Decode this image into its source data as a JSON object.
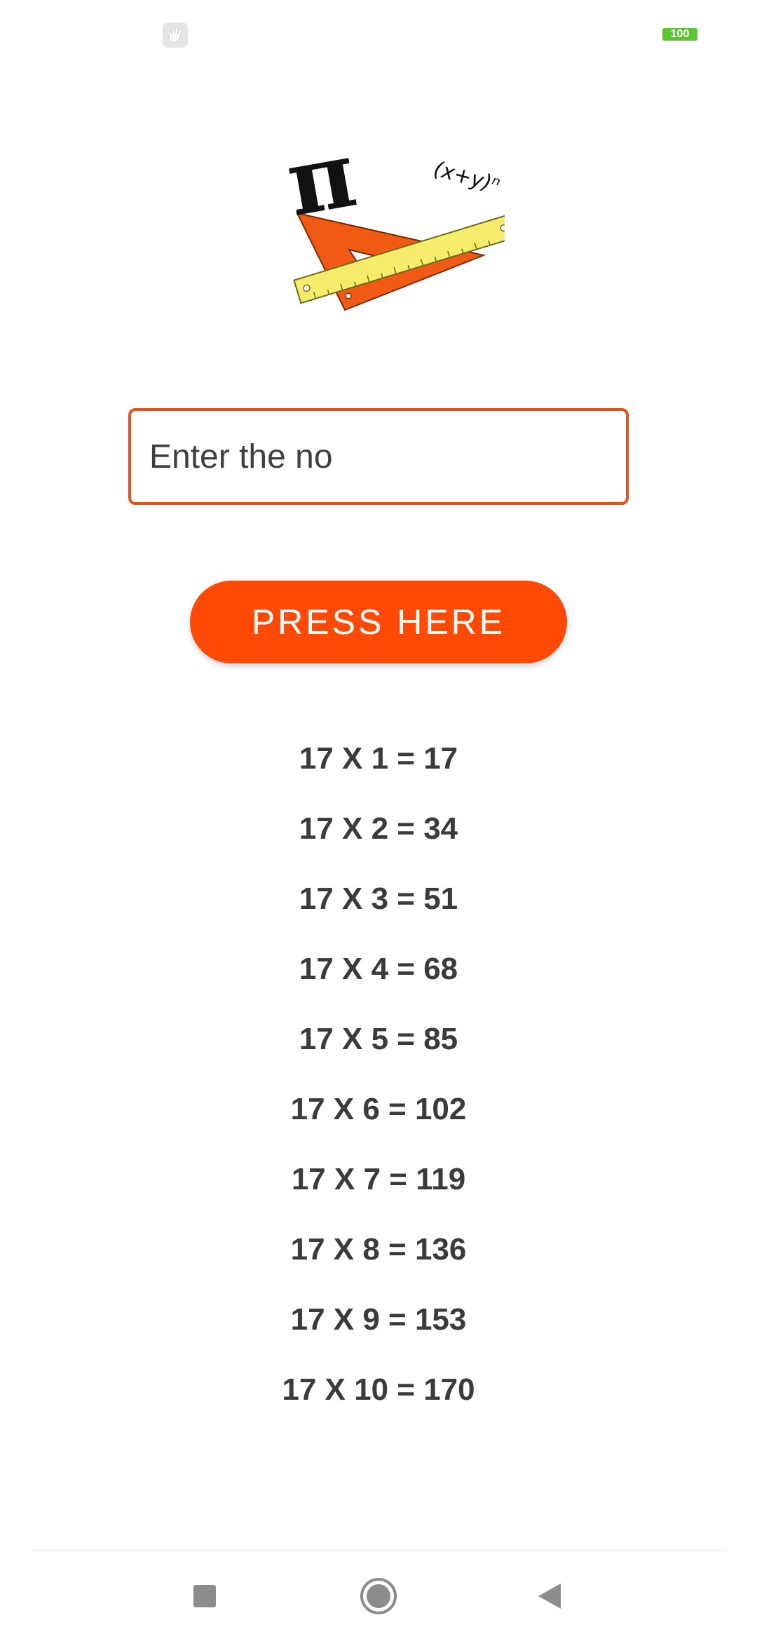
{
  "status_bar": {
    "app_icon": "hand-app-icon",
    "battery_level": "100",
    "battery_color": "#5cc531"
  },
  "logo": {
    "icon": "math-tools-logo-icon",
    "pi_symbol": "π",
    "formula": "(x+y)ⁿ"
  },
  "input": {
    "value": "",
    "placeholder": "Enter the no",
    "border_color": "#e8501a"
  },
  "button": {
    "label": "PRESS HERE",
    "color": "#ff4a05"
  },
  "results": [
    "17 X 1 = 17",
    "17 X 2 = 34",
    "17 X 3 = 51",
    "17 X 4 = 68",
    "17 X 5 = 85",
    "17 X 6 = 102",
    "17 X 7 = 119",
    "17 X 8 = 136",
    "17 X 9 = 153",
    "17 X 10 = 170"
  ],
  "nav_bar": {
    "recents_icon": "square-icon",
    "home_icon": "circle-icon",
    "back_icon": "triangle-back-icon"
  }
}
